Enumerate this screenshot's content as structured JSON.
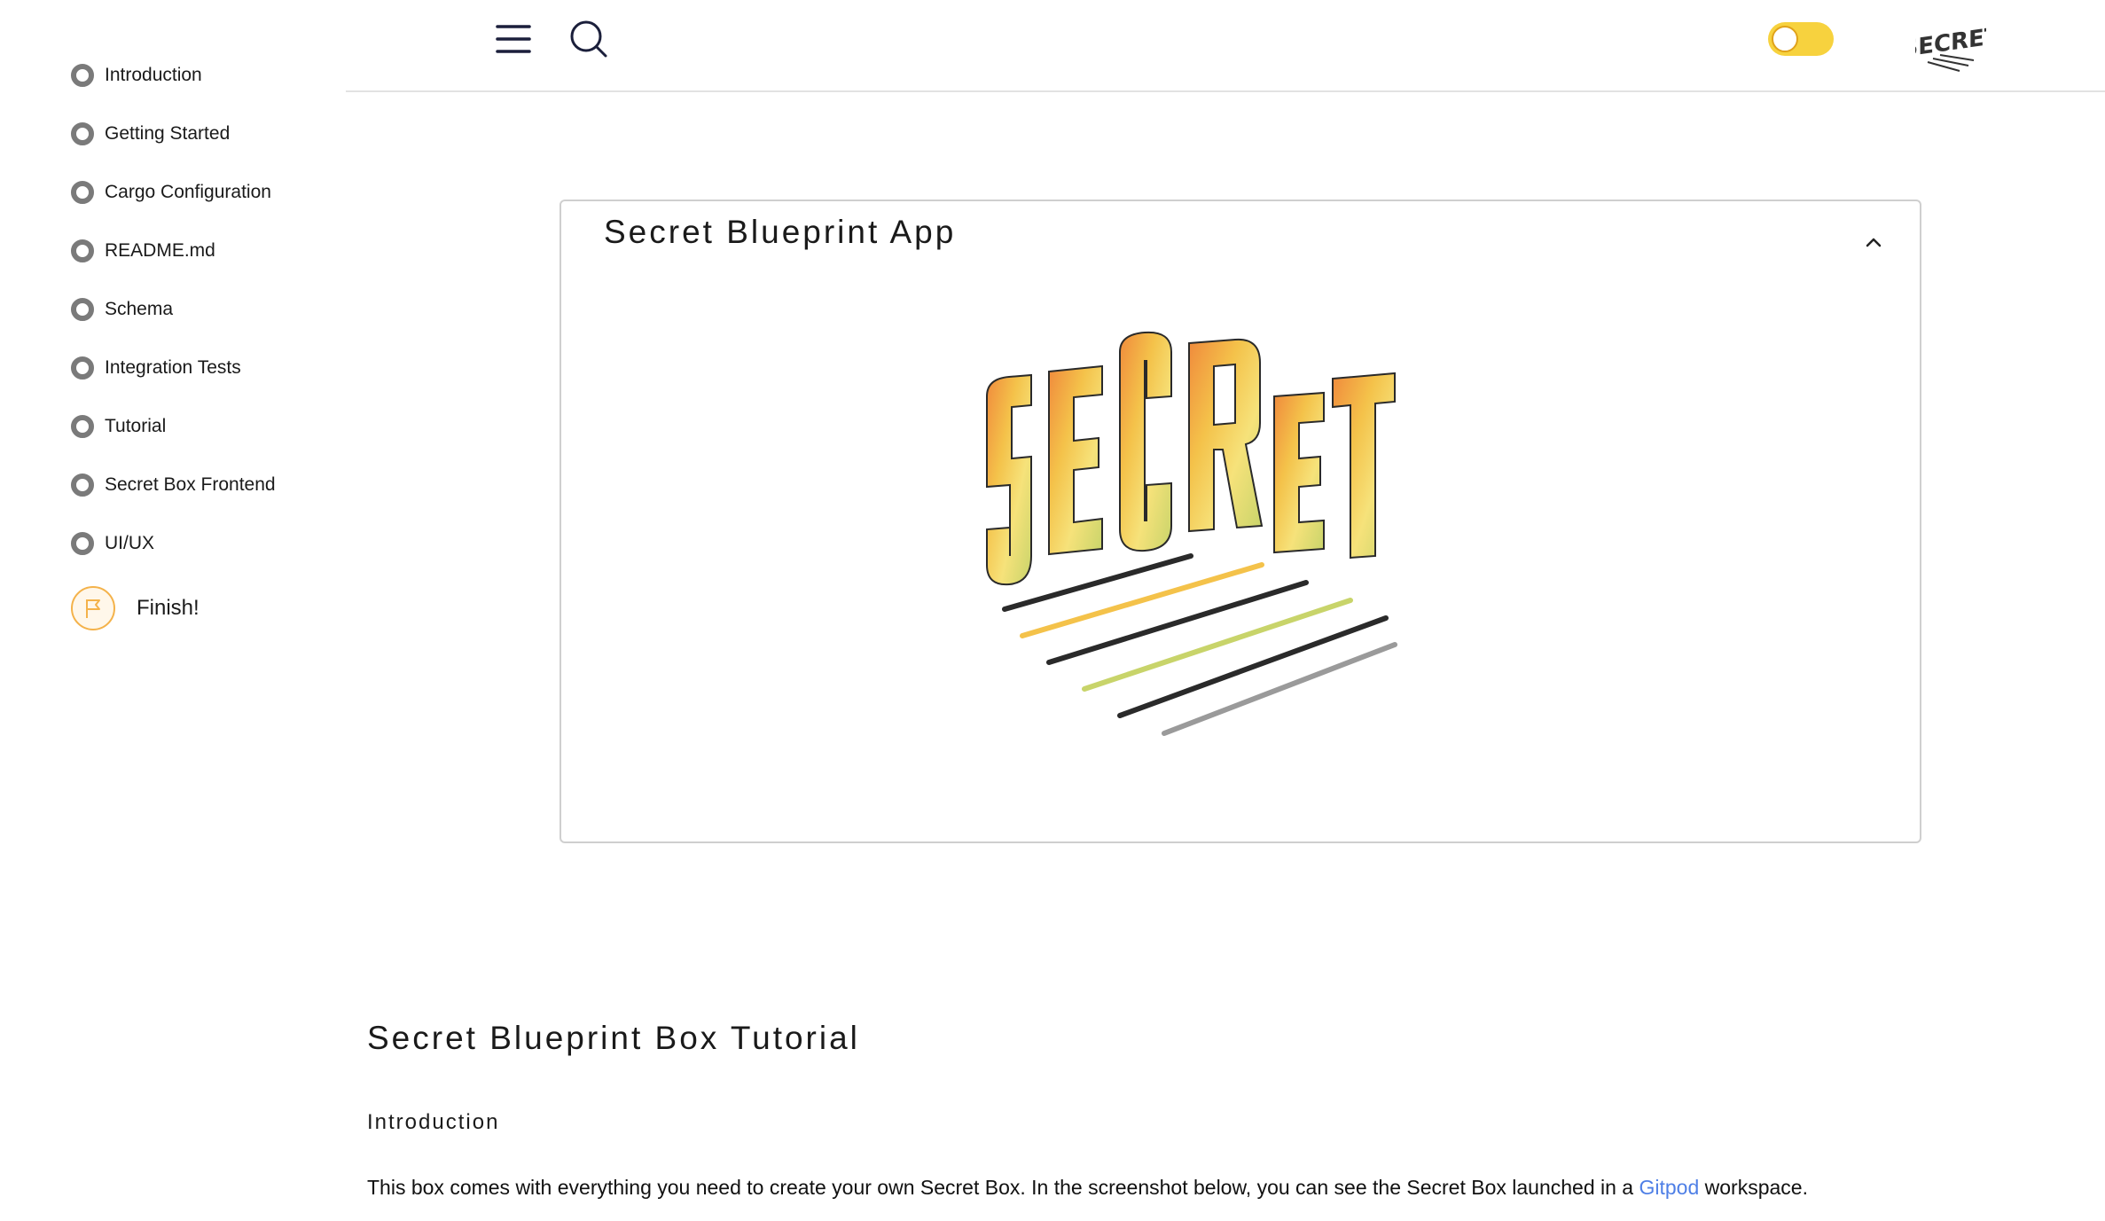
{
  "sidebar": {
    "items": [
      {
        "label": "Introduction"
      },
      {
        "label": "Getting Started"
      },
      {
        "label": "Cargo Configuration"
      },
      {
        "label": "README.md"
      },
      {
        "label": "Schema"
      },
      {
        "label": "Integration Tests"
      },
      {
        "label": "Tutorial"
      },
      {
        "label": "Secret Box Frontend"
      },
      {
        "label": "UI/UX"
      }
    ],
    "finish": {
      "label": "Finish!",
      "icon": "flag-icon"
    }
  },
  "header": {
    "menu_icon": "hamburger-menu-icon",
    "search_icon": "search-icon",
    "theme_toggle": {
      "state": "off",
      "color": "#f7d23e"
    },
    "logo_text": "SECRET"
  },
  "card": {
    "title": "Secret Blueprint App",
    "collapse_icon": "chevron-up-icon",
    "image_text": "SECRET"
  },
  "content": {
    "heading": "Secret Blueprint Box Tutorial",
    "subheading": "Introduction",
    "paragraph_before": "This box comes with everything you need to create your own Secret Box. In the screenshot below, you can see the Secret Box launched in a ",
    "link_text": "Gitpod",
    "paragraph_after": " workspace."
  },
  "colors": {
    "accent_yellow": "#f7d23e",
    "link_blue": "#4e7fe6",
    "bullet_gray": "#7a7a7a",
    "finish_orange": "#f4b24a"
  }
}
